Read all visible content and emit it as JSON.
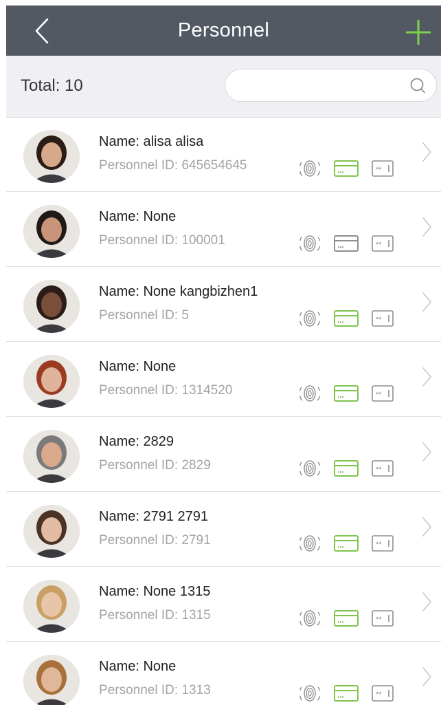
{
  "header": {
    "title": "Personnel",
    "icons": {
      "back": "chevron-left-icon",
      "add": "plus-icon"
    },
    "accent": "#7fd34a"
  },
  "filter": {
    "total_text": "Total: 10",
    "search_placeholder": "",
    "search_icon": "search-icon"
  },
  "people": [
    {
      "name": "Name: alisa alisa",
      "personnel_id": "Personnel ID: 645654645",
      "card_active": true
    },
    {
      "name": "Name: None",
      "personnel_id": "Personnel ID: 100001",
      "card_active": false
    },
    {
      "name": "Name: None kangbizhen1",
      "personnel_id": "Personnel ID: 5",
      "card_active": true
    },
    {
      "name": "Name: None",
      "personnel_id": "Personnel ID: 1314520",
      "card_active": true
    },
    {
      "name": "Name: 2829",
      "personnel_id": "Personnel ID: 2829",
      "card_active": true
    },
    {
      "name": "Name: 2791 2791",
      "personnel_id": "Personnel ID: 2791",
      "card_active": true
    },
    {
      "name": "Name: None 1315",
      "personnel_id": "Personnel ID: 1315",
      "card_active": true
    },
    {
      "name": "Name: None",
      "personnel_id": "Personnel ID: 1313",
      "card_active": true
    }
  ],
  "row_icons": {
    "fingerprint": "fingerprint-icon",
    "card": "card-icon",
    "password": "password-icon",
    "chevron": "chevron-right-icon"
  },
  "colors": {
    "header_bg": "#525962",
    "card_active": "#7fc44e",
    "icon_gray": "#8e8e93"
  }
}
